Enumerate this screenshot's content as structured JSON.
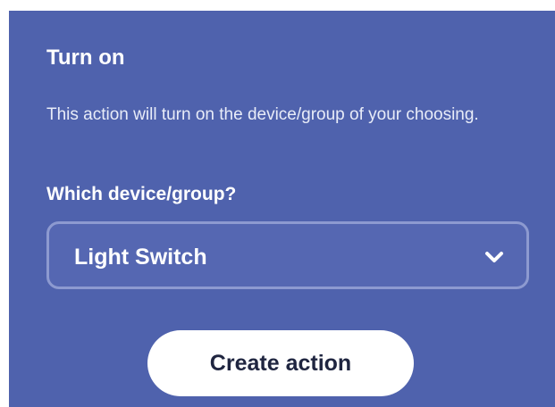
{
  "panel": {
    "title": "Turn on",
    "description": "This action will turn on the device/group of your choosing.",
    "field_label": "Which device/group?",
    "select": {
      "value": "Light Switch",
      "icon": "chevron-down-icon"
    },
    "create_button_label": "Create action"
  },
  "colors": {
    "panel_background": "#4f62ad",
    "select_border": "#8d9ad0",
    "button_background": "#ffffff",
    "button_text": "#1f2540"
  }
}
